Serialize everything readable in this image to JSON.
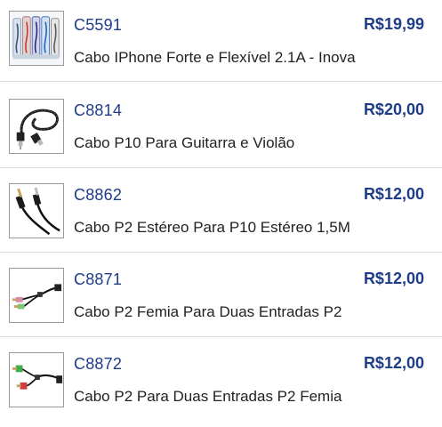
{
  "products": [
    {
      "code": "C5591",
      "price": "R$19,99",
      "title": "Cabo IPhone Forte e Flexível 2.1A - Inova",
      "thumbnail_icon": "iphone-cable-pack-icon"
    },
    {
      "code": "C8814",
      "price": "R$20,00",
      "title": "Cabo P10 Para Guitarra e Violão",
      "thumbnail_icon": "p10-guitar-cable-icon"
    },
    {
      "code": "C8862",
      "price": "R$12,00",
      "title": "Cabo P2 Estéreo Para P10 Estéreo 1,5M",
      "thumbnail_icon": "p2-to-p10-cable-icon"
    },
    {
      "code": "C8871",
      "price": "R$12,00",
      "title": "Cabo P2 Femia Para Duas Entradas P2",
      "thumbnail_icon": "p2-splitter-cable-icon"
    },
    {
      "code": "C8872",
      "price": "R$12,00",
      "title": "Cabo P2 Para Duas Entradas P2 Femia",
      "thumbnail_icon": "p2-y-adapter-cable-icon"
    }
  ],
  "colors": {
    "code": "#1f3c88",
    "price": "#1f3c88",
    "title": "#222222",
    "divider": "#dcdcdc"
  }
}
